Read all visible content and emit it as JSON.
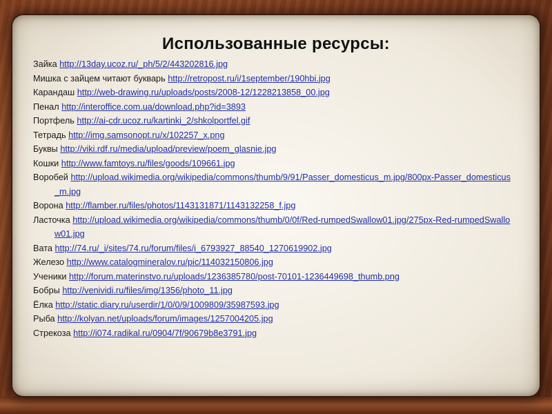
{
  "title": "Использованные ресурсы:",
  "resources": [
    {
      "name": "Зайка",
      "url": "http://13day.ucoz.ru/_ph/5/2/443202816.jpg"
    },
    {
      "name": "Мишка с зайцем читают букварь",
      "url": "http://retropost.ru/i/1september/190hbi.jpg"
    },
    {
      "name": "Карандаш",
      "url": "http://web-drawing.ru/uploads/posts/2008-12/1228213858_00.jpg"
    },
    {
      "name": "Пенал",
      "url": "http://interoffice.com.ua/download.php?id=3893"
    },
    {
      "name": "Портфель",
      "url": "http://ai-cdr.ucoz.ru/kartinki_2/shkolportfel.gif"
    },
    {
      "name": "Тетрадь",
      "url": "http://img.samsonopt.ru/x/102257_x.png"
    },
    {
      "name": "Буквы",
      "url": "http://viki.rdf.ru/media/upload/preview/poem_glasnie.jpg"
    },
    {
      "name": "Кошки",
      "url": "http://www.famtoys.ru/files/goods/109661.jpg"
    },
    {
      "name": "Воробей",
      "url": "http://upload.wikimedia.org/wikipedia/commons/thumb/9/91/Passer_domesticus_m.jpg/800px-Passer_domesticus_m.jpg"
    },
    {
      "name": "Ворона",
      "url": "http://flamber.ru/files/photos/1143131871/1143132258_f.jpg"
    },
    {
      "name": "Ласточка",
      "url": "http://upload.wikimedia.org/wikipedia/commons/thumb/0/0f/Red-rumpedSwallow01.jpg/275px-Red-rumpedSwallow01.jpg"
    },
    {
      "name": "Вата",
      "url": "http://74.ru/_i/sites/74.ru/forum/files/i_6793927_88540_1270619902.jpg"
    },
    {
      "name": "Железо",
      "url": "http://www.catalogmineralov.ru/pic/114032150806.jpg"
    },
    {
      "name": "Ученики",
      "url": "http://forum.materinstvo.ru/uploads/1236385780/post-70101-1236449698_thumb.png"
    },
    {
      "name": "Бобры",
      "url": "http://venividi.ru/files/img/1356/photo_11.jpg"
    },
    {
      "name": "Ёлка",
      "url": "http://static.diary.ru/userdir/1/0/0/9/1009809/35987593.jpg"
    },
    {
      "name": "Рыба",
      "url": "http://kolyan.net/uploads/forum/images/1257004205.jpg"
    },
    {
      "name": "Стрекоза",
      "url": "http://i074.radikal.ru/0904/7f/90679b8e3791.jpg"
    }
  ]
}
